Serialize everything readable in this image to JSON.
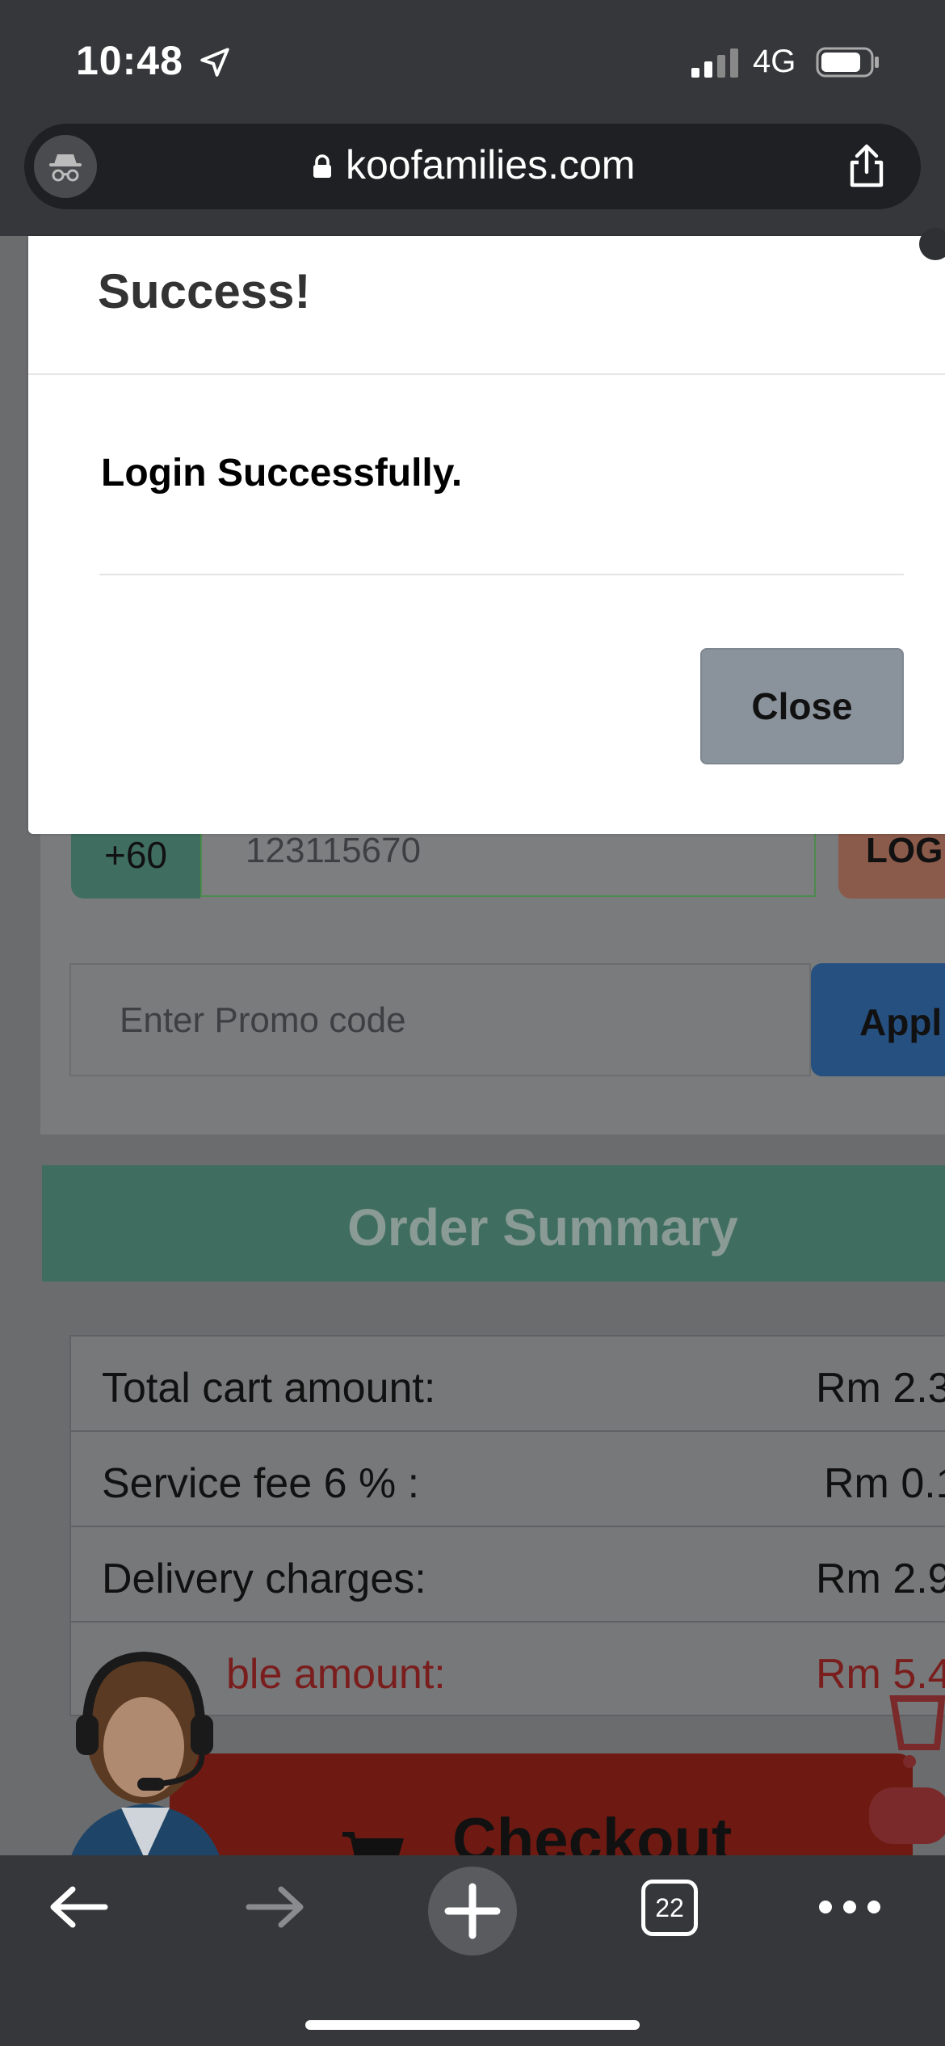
{
  "status_bar": {
    "time": "10:48",
    "network": "4G"
  },
  "browser": {
    "url": "koofamilies.com",
    "tab_count": "22"
  },
  "modal": {
    "title": "Success!",
    "message": "Login Successfully.",
    "close_label": "Close"
  },
  "login_form": {
    "country_code": "+60",
    "phone_value": "123115670",
    "login_label": "LOG",
    "promo_placeholder": "Enter Promo code",
    "apply_label": "Appl"
  },
  "order_summary": {
    "title": "Order Summary",
    "rows": [
      {
        "label": "Total cart amount:",
        "value": "Rm 2.3"
      },
      {
        "label": "Service fee 6 % :",
        "value": "Rm 0.1"
      },
      {
        "label": "Delivery charges:",
        "value": "Rm 2.9"
      },
      {
        "label": "ble amount:",
        "value": "Rm 5.4"
      }
    ],
    "checkout_label": "Checkout"
  },
  "colors": {
    "accent_green": "#3f6e60",
    "checkout_red": "#6e1a12",
    "apply_blue": "#265080",
    "close_gray": "#8a929c"
  }
}
